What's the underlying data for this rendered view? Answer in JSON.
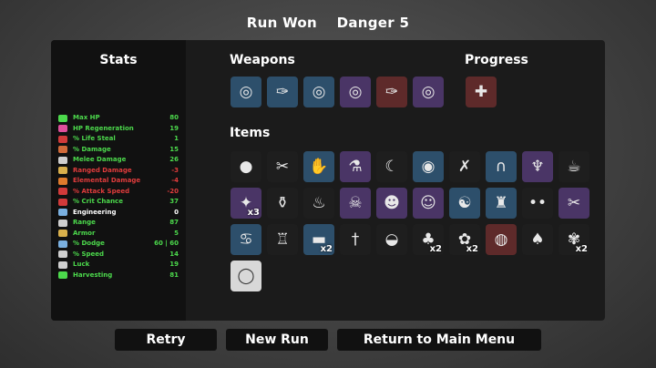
{
  "header": {
    "result": "Run Won",
    "danger": "Danger 5"
  },
  "stats": {
    "title": "Stats",
    "rows": [
      {
        "name": "Max HP",
        "value": "80",
        "color": "#4cd94c",
        "icon_color": "#4cd94c",
        "icon": "heart-icon"
      },
      {
        "name": "HP Regeneration",
        "value": "19",
        "color": "#4cd94c",
        "icon_color": "#e04f9c",
        "icon": "regen-icon"
      },
      {
        "name": "% Life Steal",
        "value": "1",
        "color": "#4cd94c",
        "icon_color": "#d13a3a",
        "icon": "lifesteal-icon"
      },
      {
        "name": "% Damage",
        "value": "15",
        "color": "#4cd94c",
        "icon_color": "#d16a3a",
        "icon": "damage-icon"
      },
      {
        "name": "Melee Damage",
        "value": "26",
        "color": "#4cd94c",
        "icon_color": "#cfcfcf",
        "icon": "melee-icon"
      },
      {
        "name": "Ranged Damage",
        "value": "-3",
        "color": "#e03c3c",
        "icon_color": "#d9b04c",
        "icon": "ranged-icon"
      },
      {
        "name": "Elemental Damage",
        "value": "-4",
        "color": "#e03c3c",
        "icon_color": "#e07b2c",
        "icon": "elemental-icon"
      },
      {
        "name": "% Attack Speed",
        "value": "-20",
        "color": "#e03c3c",
        "icon_color": "#d13a3a",
        "icon": "attack-speed-icon"
      },
      {
        "name": "% Crit Chance",
        "value": "37",
        "color": "#4cd94c",
        "icon_color": "#d13a3a",
        "icon": "crit-icon"
      },
      {
        "name": "Engineering",
        "value": "0",
        "color": "#ffffff",
        "icon_color": "#7ab0e0",
        "icon": "engineering-icon"
      },
      {
        "name": "Range",
        "value": "87",
        "color": "#4cd94c",
        "icon_color": "#cfcfcf",
        "icon": "range-icon"
      },
      {
        "name": "Armor",
        "value": "5",
        "color": "#4cd94c",
        "icon_color": "#d9b04c",
        "icon": "armor-icon"
      },
      {
        "name": "% Dodge",
        "value": "60 | 60",
        "color": "#4cd94c",
        "icon_color": "#7ab0e0",
        "icon": "dodge-icon"
      },
      {
        "name": "% Speed",
        "value": "14",
        "color": "#4cd94c",
        "icon_color": "#cfcfcf",
        "icon": "speed-icon"
      },
      {
        "name": "Luck",
        "value": "19",
        "color": "#4cd94c",
        "icon_color": "#cfcfcf",
        "icon": "luck-icon"
      },
      {
        "name": "Harvesting",
        "value": "81",
        "color": "#4cd94c",
        "icon_color": "#4cd94c",
        "icon": "harvesting-icon"
      }
    ]
  },
  "weapons": {
    "title": "Weapons",
    "items": [
      {
        "icon": "circular-saw-icon",
        "glyph": "◎",
        "tier": "blue"
      },
      {
        "icon": "wrench-icon",
        "glyph": "✑",
        "tier": "blue"
      },
      {
        "icon": "circular-saw-icon",
        "glyph": "◎",
        "tier": "blue"
      },
      {
        "icon": "circular-saw-icon",
        "glyph": "◎",
        "tier": "purple"
      },
      {
        "icon": "wrench-icon",
        "glyph": "✑",
        "tier": "red"
      },
      {
        "icon": "circular-saw-icon",
        "glyph": "◎",
        "tier": "purple"
      }
    ]
  },
  "progress": {
    "title": "Progress",
    "items": [
      {
        "icon": "medkit-icon",
        "glyph": "✚",
        "tier": "red"
      }
    ]
  },
  "items": {
    "title": "Items",
    "list": [
      {
        "icon": "rock-icon",
        "glyph": "●",
        "tier": "common",
        "qty": ""
      },
      {
        "icon": "chainsaw-icon",
        "glyph": "✂",
        "tier": "common",
        "qty": ""
      },
      {
        "icon": "gloves-icon",
        "glyph": "✋",
        "tier": "blue",
        "qty": ""
      },
      {
        "icon": "potion-icon",
        "glyph": "⚗",
        "tier": "purple",
        "qty": ""
      },
      {
        "icon": "crescent-icon",
        "glyph": "☾",
        "tier": "common",
        "qty": ""
      },
      {
        "icon": "ring-icon",
        "glyph": "◉",
        "tier": "blue",
        "qty": ""
      },
      {
        "icon": "feather-icon",
        "glyph": "✗",
        "tier": "common",
        "qty": ""
      },
      {
        "icon": "horseshoe-icon",
        "glyph": "∩",
        "tier": "blue",
        "qty": ""
      },
      {
        "icon": "fangs-icon",
        "glyph": "♆",
        "tier": "purple",
        "qty": ""
      },
      {
        "icon": "coffee-icon",
        "glyph": "☕",
        "tier": "common",
        "qty": ""
      },
      {
        "icon": "wand-icon",
        "glyph": "✦",
        "tier": "purple",
        "qty": "x3"
      },
      {
        "icon": "jar-icon",
        "glyph": "⚱",
        "tier": "common",
        "qty": ""
      },
      {
        "icon": "duck-icon",
        "glyph": "♨",
        "tier": "common",
        "qty": ""
      },
      {
        "icon": "ghost-icon",
        "glyph": "☠",
        "tier": "purple",
        "qty": ""
      },
      {
        "icon": "zombie-icon",
        "glyph": "☻",
        "tier": "purple",
        "qty": ""
      },
      {
        "icon": "angel-icon",
        "glyph": "☺",
        "tier": "purple",
        "qty": ""
      },
      {
        "icon": "ninja-icon",
        "glyph": "☯",
        "tier": "blue",
        "qty": ""
      },
      {
        "icon": "anvil-icon",
        "glyph": "♜",
        "tier": "blue",
        "qty": ""
      },
      {
        "icon": "eyes-icon",
        "glyph": "••",
        "tier": "common",
        "qty": ""
      },
      {
        "icon": "scissors-icon",
        "glyph": "✂",
        "tier": "purple",
        "qty": ""
      },
      {
        "icon": "pig-icon",
        "glyph": "♋",
        "tier": "blue",
        "qty": ""
      },
      {
        "icon": "tooth-icon",
        "glyph": "♖",
        "tier": "common",
        "qty": ""
      },
      {
        "icon": "sausage-icon",
        "glyph": "▬",
        "tier": "blue",
        "qty": "x2"
      },
      {
        "icon": "dagger-icon",
        "glyph": "†",
        "tier": "common",
        "qty": ""
      },
      {
        "icon": "helmet-icon",
        "glyph": "◒",
        "tier": "common",
        "qty": ""
      },
      {
        "icon": "tree-icon",
        "glyph": "♣",
        "tier": "common",
        "qty": "x2"
      },
      {
        "icon": "alien-icon",
        "glyph": "✿",
        "tier": "common",
        "qty": "x2"
      },
      {
        "icon": "pumpkin-icon",
        "glyph": "◍",
        "tier": "red",
        "qty": ""
      },
      {
        "icon": "plant-icon",
        "glyph": "♠",
        "tier": "common",
        "qty": ""
      },
      {
        "icon": "bee-icon",
        "glyph": "✾",
        "tier": "common",
        "qty": "x2"
      },
      {
        "icon": "egg-icon",
        "glyph": "◯",
        "tier": "white",
        "qty": ""
      }
    ]
  },
  "buttons": {
    "retry": "Retry",
    "new_run": "New Run",
    "main_menu": "Return to Main Menu"
  }
}
